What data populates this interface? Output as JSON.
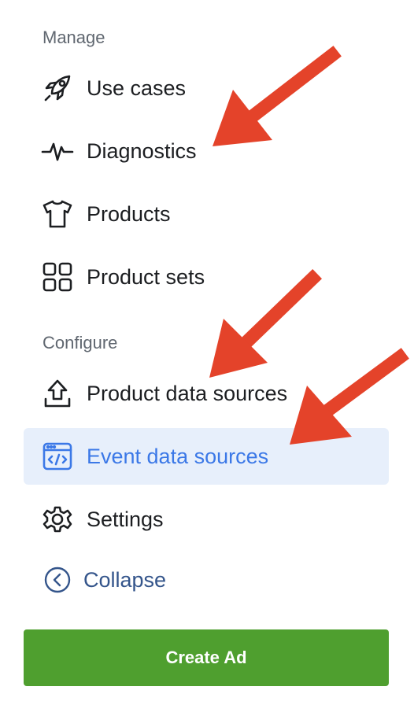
{
  "sections": {
    "manage_title": "Manage",
    "configure_title": "Configure"
  },
  "nav": {
    "use_cases": {
      "label": "Use cases",
      "icon": "rocket-icon"
    },
    "diagnostics": {
      "label": "Diagnostics",
      "icon": "pulse-icon"
    },
    "products": {
      "label": "Products",
      "icon": "tshirt-icon"
    },
    "product_sets": {
      "label": "Product sets",
      "icon": "grid-icon"
    },
    "product_data_sources": {
      "label": "Product data sources",
      "icon": "upload-icon"
    },
    "event_data_sources": {
      "label": "Event data sources",
      "icon": "code-window-icon",
      "active": true
    },
    "settings": {
      "label": "Settings",
      "icon": "gear-icon"
    }
  },
  "collapse": {
    "label": "Collapse",
    "icon": "chevron-left-circle-icon"
  },
  "create_ad": {
    "label": "Create Ad"
  },
  "colors": {
    "accent": "#3b78e7",
    "active_bg": "#e7effb",
    "cta_green": "#4f9f2f",
    "annotation_arrow": "#e4432a",
    "collapse_text": "#34558b"
  }
}
